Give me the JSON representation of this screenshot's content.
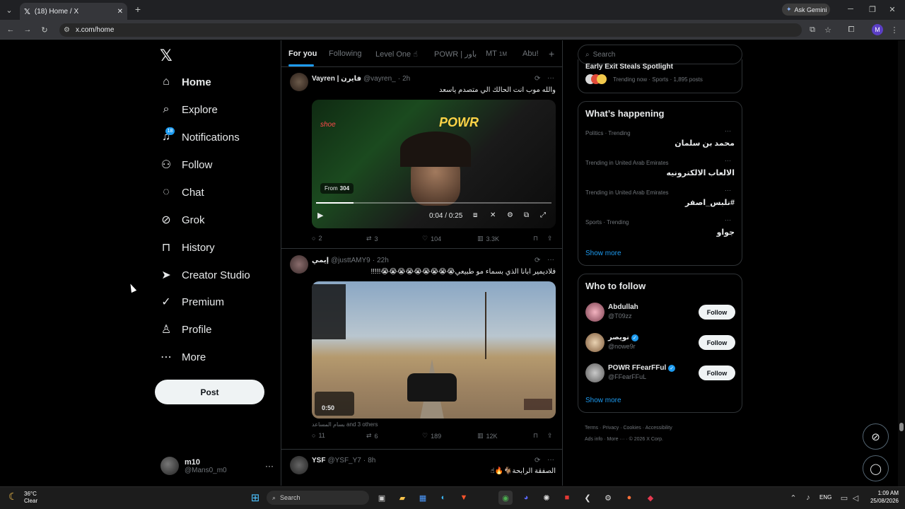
{
  "browser": {
    "tab_title": "(18) Home / X",
    "url": "x.com/home",
    "gemini_label": "Ask Gemini",
    "profile_initial": "M"
  },
  "nav": {
    "items": [
      {
        "label": "Home",
        "icon": "home-icon",
        "active": true
      },
      {
        "label": "Explore",
        "icon": "search-icon"
      },
      {
        "label": "Notifications",
        "icon": "bell-icon",
        "badge": "18"
      },
      {
        "label": "Follow",
        "icon": "person-add-icon"
      },
      {
        "label": "Chat",
        "icon": "chat-icon"
      },
      {
        "label": "Grok",
        "icon": "grok-icon"
      },
      {
        "label": "History",
        "icon": "bookmark-icon"
      },
      {
        "label": "Creator Studio",
        "icon": "rocket-icon"
      },
      {
        "label": "Premium",
        "icon": "verified-icon"
      },
      {
        "label": "Profile",
        "icon": "profile-icon"
      },
      {
        "label": "More",
        "icon": "more-circle-icon"
      }
    ],
    "post_button": "Post",
    "account": {
      "name": "m10",
      "handle": "@Mans0_m0"
    }
  },
  "feed": {
    "tabs": [
      "For you",
      "Following",
      "Level One ☝",
      "POWR | باور",
      "MT",
      "Abu!"
    ],
    "tab_badge": "1M",
    "posts": [
      {
        "name": "Vayren | فايرن",
        "handle": "@vayren_",
        "time": "2h",
        "text": "والله موب انت الحالك الي متصدم ياسعد",
        "video": {
          "from_label": "From",
          "from_count": "304",
          "time": "0:04 / 0:25",
          "progress": 0.16
        },
        "stats": {
          "replies": "2",
          "reposts": "3",
          "likes": "104",
          "views": "3.3K"
        }
      },
      {
        "name": "إيمي",
        "handle": "@justtAMY9",
        "time": "22h",
        "text": "فلاديمير ابانا الذي بسماء مو طبيعي😭😭😭😭😭😭😭😭😭!!!!!",
        "video": {
          "time": "0:50"
        },
        "liked_by": "بسام المساعد and 3 others",
        "stats": {
          "replies": "11",
          "reposts": "6",
          "likes": "189",
          "views": "12K"
        }
      },
      {
        "name": "YSF",
        "handle": "@YSF_Y7",
        "time": "8h",
        "text": "الصفقة الرابحة🐐🔥☝"
      }
    ]
  },
  "right": {
    "search_placeholder": "Search",
    "top_trend": {
      "title": "Early Exit Steals Spotlight",
      "meta": "Trending now · Sports · 1,895 posts"
    },
    "happening_title": "What’s happening",
    "trends": [
      {
        "meta": "Politics · Trending",
        "name": "محمد بن سلمان"
      },
      {
        "meta": "Trending in United Arab Emirates",
        "name": "الالعاب الالكترونيه"
      },
      {
        "meta": "Trending in United Arab Emirates",
        "name": "#نلبس_اصفر"
      },
      {
        "meta": "Sports · Trending",
        "name": "جواو"
      }
    ],
    "show_more": "Show more",
    "who_title": "Who to follow",
    "follow": [
      {
        "name": "Abdullah",
        "handle": "@T09zz",
        "verified": false
      },
      {
        "name": "نويصر",
        "handle": "@nowe9r",
        "verified": true
      },
      {
        "name": "POWR FFearFFul",
        "handle": "@FFearFFuL",
        "verified": true
      }
    ],
    "follow_label": "Follow",
    "footer": [
      "Terms",
      "Privacy",
      "Cookies",
      "Accessibility",
      "Ads info",
      "More ···",
      "© 2026 X Corp."
    ]
  },
  "taskbar": {
    "weather_temp": "36°C",
    "weather_desc": "Clear",
    "search": "Search",
    "lang": "ENG",
    "time": "1:09 AM",
    "date": "25/08/2026"
  }
}
